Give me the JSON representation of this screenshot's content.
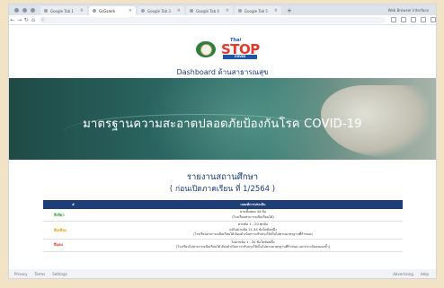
{
  "browser": {
    "tabs": [
      {
        "label": "Google Tab 1",
        "active": false
      },
      {
        "label": "GcGsmrk",
        "active": true
      },
      {
        "label": "Google Tab 3",
        "active": false
      },
      {
        "label": "Google Tab 4",
        "active": false
      },
      {
        "label": "Google Tab 5",
        "active": false
      }
    ],
    "new_tab_label": "+",
    "window_label": "Web Browser Interface",
    "url": "ⓘ"
  },
  "page": {
    "header_title": "Dashboard ด้านสาธารณสุข",
    "logo_thai": "Thai",
    "logo_stop": "STOP",
    "logo_covid": "COVID",
    "banner_text": "มาตรฐานความสะอาดปลอดภัยป้องกันโรค COVID-19",
    "section_title": "รายงานสถานศึกษา",
    "section_subtitle": "( ก่อนเปิดภาคเรียน ที่ 1/2564 )",
    "table": {
      "headers": [
        "#",
        "เกณฑ์การประเมิน"
      ],
      "rows": [
        {
          "level": "สีเขียว",
          "color": "#2e9d3c",
          "lines": [
            "ผ่านทั้งหมด 44 ข้อ",
            "(โรงเรียนสามารถเปิดเรียนได้)"
          ]
        },
        {
          "level": "สีเหลือง",
          "color": "#d4a514",
          "lines": [
            "ผ่านข้อ 1 - 20 ทุกข้อ",
            "แต่ไม่ผ่านข้อ 21-44 ข้อใดข้อหนึ่ง",
            "(โรงเรียนสามารถเปิดเรียนได้ ต้องดำเนินการปรับปรุงให้เป็นไปตามมาตรฐานที่กำหนด)"
          ]
        },
        {
          "level": "สีแดง",
          "color": "#d8392c",
          "lines": [
            "ไม่ผ่านข้อ 1 - 20 ข้อใดข้อหนึ่ง",
            "(โรงเรียนไม่สามารถเปิดเรียนได้ ต้องดำเนินการปรับปรุงให้เป็นไปตามมาตรฐานที่กำหนด และประเมินตนเองซ้ำ)"
          ]
        }
      ]
    }
  },
  "footer": {
    "left": [
      "Privacy",
      "Terms",
      "Settings"
    ],
    "right": [
      "Advertising",
      "Help"
    ]
  }
}
